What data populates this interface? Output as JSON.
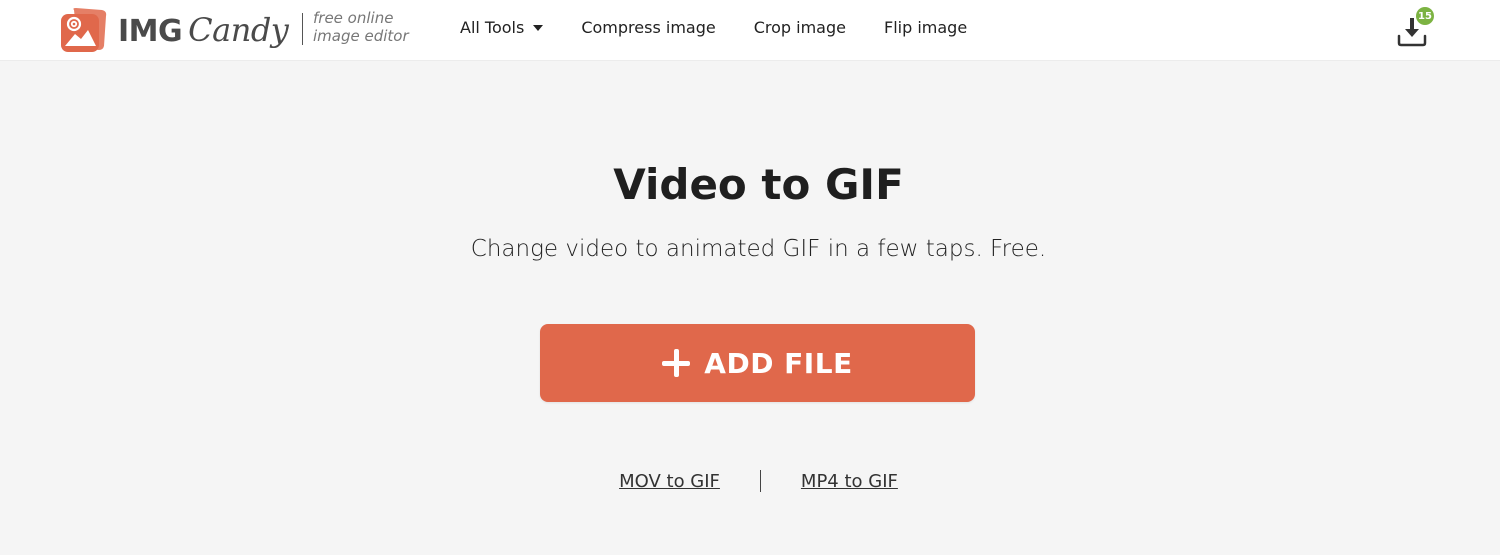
{
  "header": {
    "logo": {
      "primary": "IMG",
      "secondary": "Candy",
      "tagline_line1": "free online",
      "tagline_line2": "image editor"
    },
    "nav": [
      {
        "label": "All Tools",
        "has_dropdown": true
      },
      {
        "label": "Compress image"
      },
      {
        "label": "Crop image"
      },
      {
        "label": "Flip image"
      }
    ],
    "downloads": {
      "icon": "download-icon",
      "badge_count": "15"
    }
  },
  "main": {
    "title": "Video to GIF",
    "subtitle": "Change video to animated GIF in a few taps. Free.",
    "add_file_button": {
      "icon": "plus-icon",
      "label": "ADD FILE"
    },
    "related_links": [
      {
        "label": "MOV to GIF"
      },
      {
        "label": "MP4 to GIF"
      }
    ]
  },
  "colors": {
    "brand": "#e0684b",
    "badge": "#7cb342",
    "background": "#f5f5f5",
    "header_background": "#ffffff"
  }
}
